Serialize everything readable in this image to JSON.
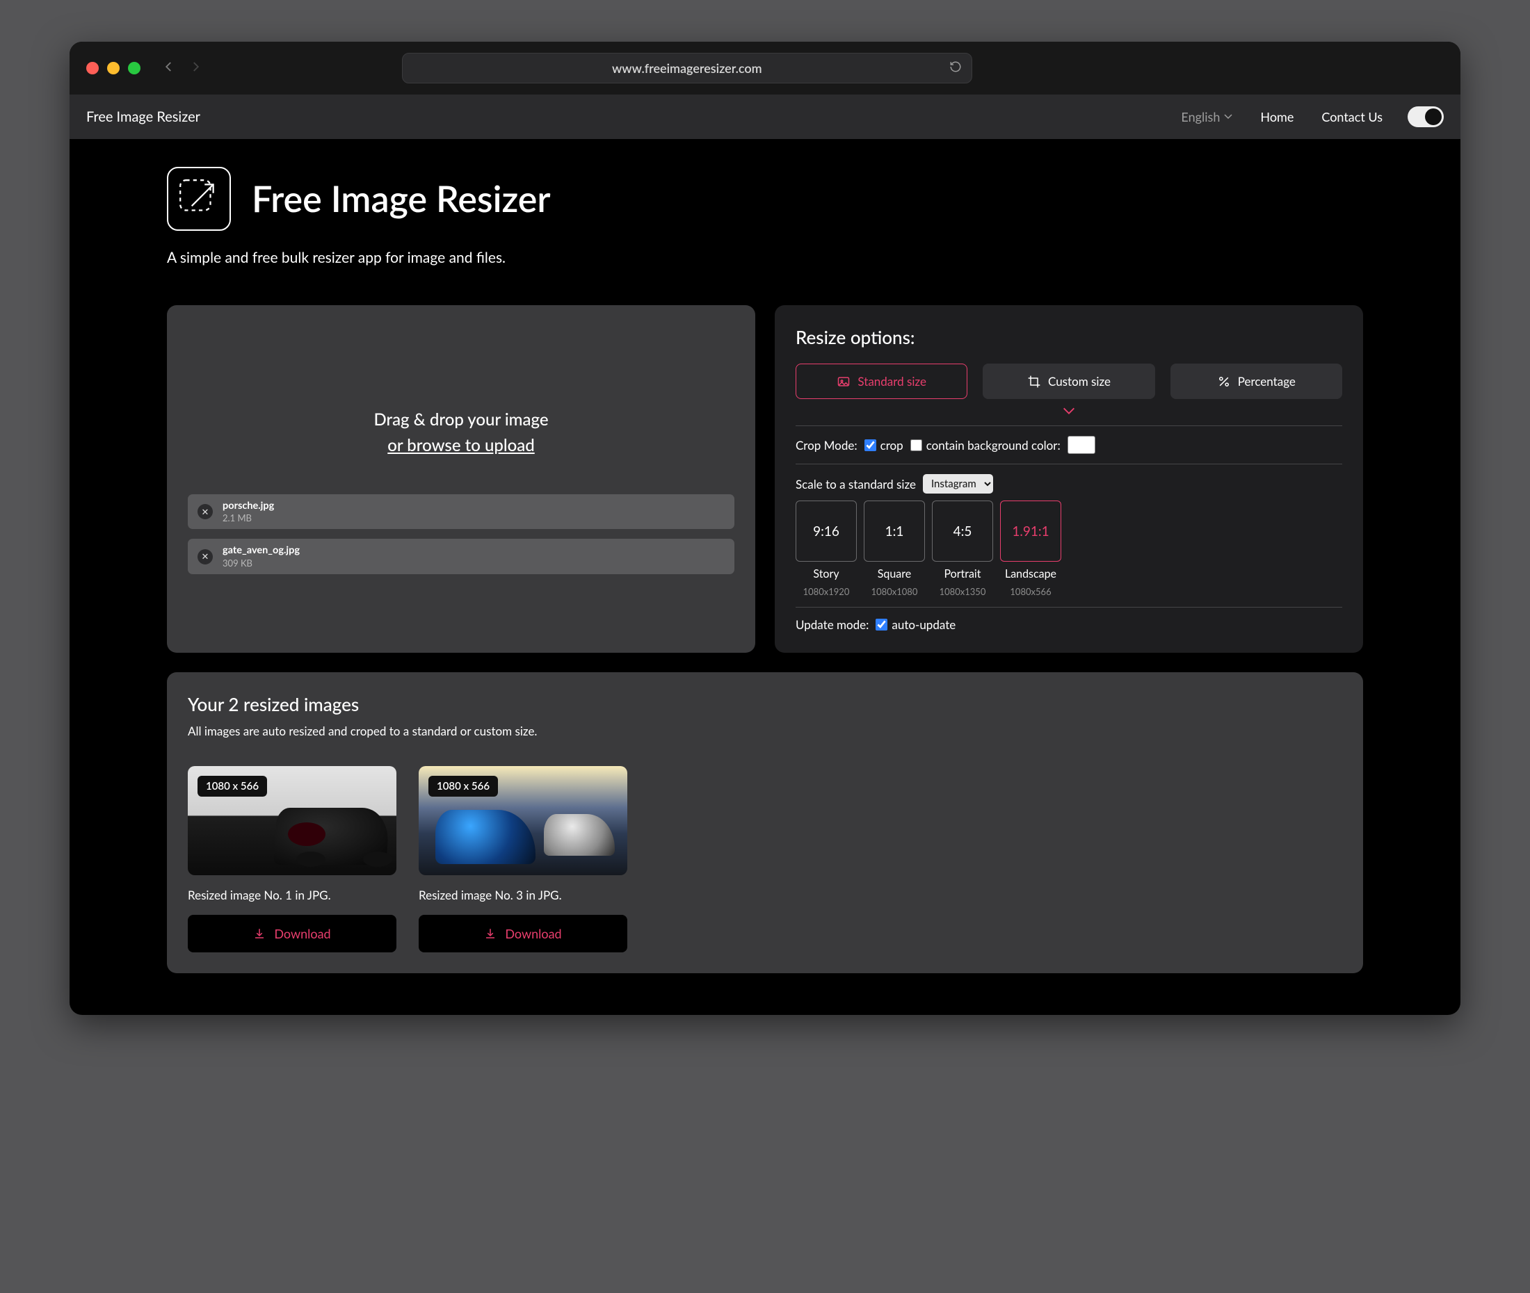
{
  "browser": {
    "url": "www.freeimageresizer.com"
  },
  "navbar": {
    "brand": "Free Image Resizer",
    "language": "English",
    "home": "Home",
    "contact": "Contact Us"
  },
  "hero": {
    "title": "Free Image Resizer",
    "subtitle": "A simple and free bulk resizer app for image and files."
  },
  "upload": {
    "drag_text": "Drag & drop your image",
    "browse_text": "or browse to upload",
    "files": [
      {
        "name": "porsche.jpg",
        "size": "2.1 MB"
      },
      {
        "name": "gate_aven_og.jpg",
        "size": "309 KB"
      }
    ]
  },
  "options": {
    "heading": "Resize options:",
    "tabs": {
      "standard": "Standard size",
      "custom": "Custom size",
      "percent": "Percentage"
    },
    "crop_mode_label": "Crop Mode:",
    "crop_label": "crop",
    "contain_label": "contain background color:",
    "scale_label": "Scale to a standard size",
    "scale_select": "Instagram",
    "ratios": [
      {
        "ratio": "9:16",
        "label": "Story",
        "dim": "1080x1920"
      },
      {
        "ratio": "1:1",
        "label": "Square",
        "dim": "1080x1080"
      },
      {
        "ratio": "4:5",
        "label": "Portrait",
        "dim": "1080x1350"
      },
      {
        "ratio": "1.91:1",
        "label": "Landscape",
        "dim": "1080x566"
      }
    ],
    "update_mode_label": "Update mode:",
    "auto_update_label": "auto-update"
  },
  "results": {
    "heading": "Your 2 resized images",
    "sub": "All images are auto resized and croped to a standard or custom size.",
    "items": [
      {
        "badge": "1080 x 566",
        "caption": "Resized image No. 1 in JPG.",
        "download": "Download"
      },
      {
        "badge": "1080 x 566",
        "caption": "Resized image No. 3 in JPG.",
        "download": "Download"
      }
    ]
  }
}
